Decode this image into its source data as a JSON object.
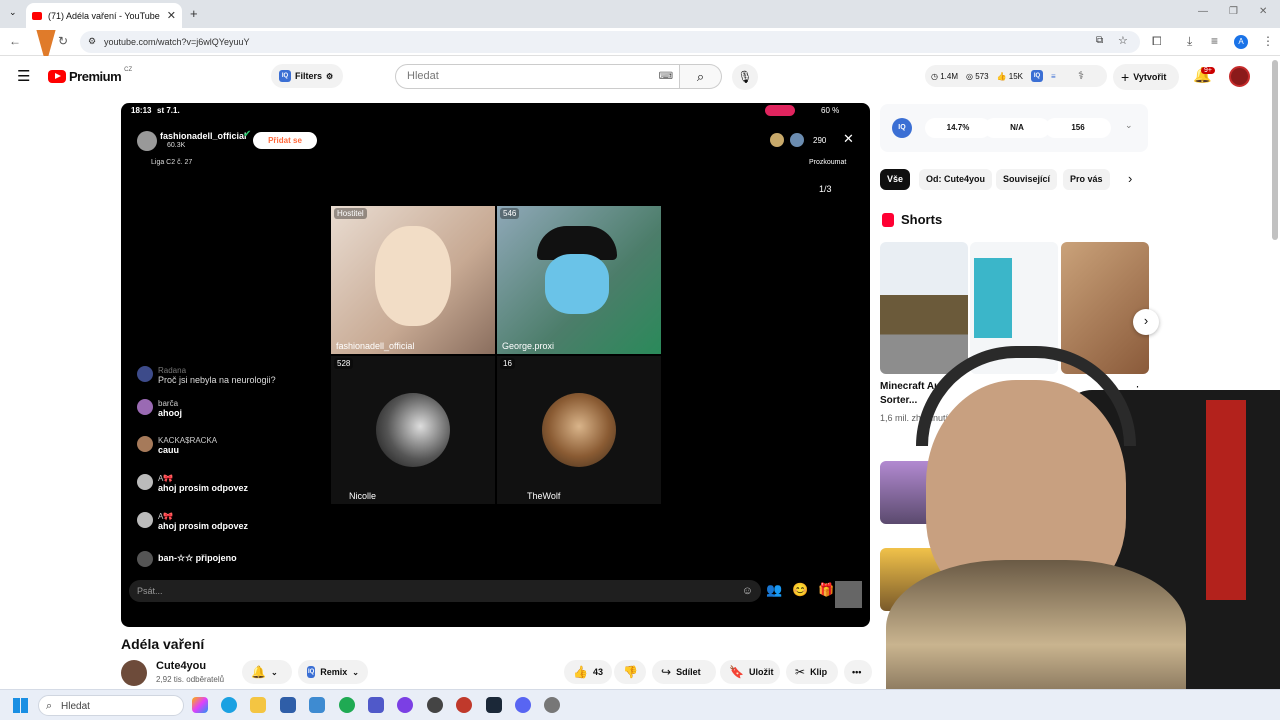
{
  "browser": {
    "tab_title": "(71) Adéla vaření - YouTube",
    "url": "youtube.com/watch?v=j6wlQYeyuuY"
  },
  "header": {
    "logo_text": "Premium",
    "region": "CZ",
    "filters_label": "Filters",
    "search_placeholder": "Hledat",
    "stats": {
      "views": "1.4M",
      "comments": "573",
      "likes": "15K"
    },
    "create_label": "Vytvořit",
    "notifications": "9+"
  },
  "video": {
    "status_time": "18:13",
    "status_date": "st 7.1.",
    "battery": "60 %",
    "host_name": "fashionadell_official",
    "host_followers": "60.3K",
    "join_label": "Přidat se",
    "league": "Liga C2 č. 27",
    "viewers": "290",
    "explore_label": "Prozkoumat",
    "page_counter": "1/3",
    "participants": [
      {
        "badge": "Hostitel",
        "name": "fashionadell_official"
      },
      {
        "badge": "546",
        "name": "George.proxi"
      },
      {
        "badge": "528",
        "name": "Nicolle"
      },
      {
        "badge": "16",
        "name": "TheWolf"
      }
    ],
    "chat": [
      {
        "name": "Radana",
        "msg": "Proč jsi nebyla na neurologii?"
      },
      {
        "name": "barča",
        "msg": "ahooj"
      },
      {
        "name": "KACKA$RACKA",
        "msg": "cauu"
      },
      {
        "name": "A🎀",
        "msg": "ahoj prosim odpovez"
      },
      {
        "name": "A🎀",
        "msg": "ahoj prosim odpovez"
      },
      {
        "name": "",
        "msg": "ban-☆☆ připojeno"
      }
    ],
    "input_placeholder": "Psát..."
  },
  "below": {
    "title": "Adéla vaření",
    "channel": "Cute4you",
    "subscribers": "2,92 tis. odběratelů",
    "remix_label": "Remix",
    "likes": "43",
    "share_label": "Sdílet",
    "save_label": "Uložit",
    "clip_label": "Klip"
  },
  "sidebar": {
    "iq_values": [
      "14.7%",
      "N/A",
      "156"
    ],
    "chips": [
      "Vše",
      "Od: Cute4you",
      "Související",
      "Pro vás"
    ],
    "shorts_title": "Shorts",
    "short1_title": "Minecraft Auto Sorter...",
    "short1_views": "1,6 mil. zhlédnutí"
  },
  "taskbar": {
    "search_placeholder": "Hledat"
  }
}
